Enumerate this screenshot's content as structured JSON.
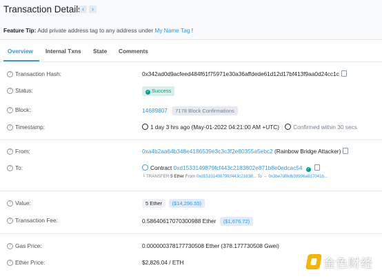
{
  "header": {
    "title": "Transaction Details",
    "prev_icon": "‹",
    "next_icon": "›"
  },
  "tip": {
    "label": "Feature Tip:",
    "text": "Add private address tag to any address under",
    "link": "My Name Tag",
    "suffix": "!"
  },
  "tabs": [
    "Overview",
    "Internal Txns",
    "State",
    "Comments"
  ],
  "rows": {
    "hash": {
      "label": "Transaction Hash:",
      "value": "0x342ad0d9acfeed484f61f75971e30a36affdede61d12d17bf413f9aa0d24cc1c"
    },
    "status": {
      "label": "Status:",
      "value": "Success"
    },
    "block": {
      "label": "Block:",
      "value": "14689807",
      "confirmations": "7178 Block Confirmations"
    },
    "timestamp": {
      "label": "Timestamp:",
      "value": "1 day 3 hrs ago (May-01-2022 04:21:00 AM +UTC)",
      "confirmed": "Confirmed within 30 secs"
    },
    "from": {
      "label": "From:",
      "address": "0xa4b2aa64b348e4186539e3c3c3f2e80355a5ebc2",
      "tag": "(Rainbow Bridge Attacker)"
    },
    "to": {
      "label": "To:",
      "prefix": "Contract",
      "address": "0xd1533149879fcf443c2183802e871b8e0edcac54",
      "transfer": {
        "label": "└ TRANSFER",
        "amount": "5 Ether",
        "from_label": "From",
        "from": "0xd1533149879fcf443c21838...",
        "to_label": "To →",
        "to": "0x3be7df8db39996a837041b..."
      }
    },
    "value": {
      "label": "Value:",
      "amount": "5 Ether",
      "usd": "($14,296.55)"
    },
    "fee": {
      "label": "Transaction Fee:",
      "amount": "0.58640617070300988 Ether",
      "usd": "($1,676.72)"
    },
    "gas": {
      "label": "Gas Price:",
      "value": "0.000000378177730508 Ether (378.177730508 Gwei)"
    },
    "ether_price": {
      "label": "Ether Price:",
      "value": "$2,826.04 / ETH"
    }
  },
  "watermark": {
    "text": "金色财经"
  },
  "colors": {
    "accent": "#3498db",
    "success": "#00a186",
    "background": "#f8f9fa",
    "card": "#ffffff"
  },
  "icons": [
    "question-circle-icon",
    "copy-icon",
    "check-circle-icon",
    "clock-icon",
    "chevron-left-icon",
    "chevron-right-icon",
    "contract-icon"
  ]
}
